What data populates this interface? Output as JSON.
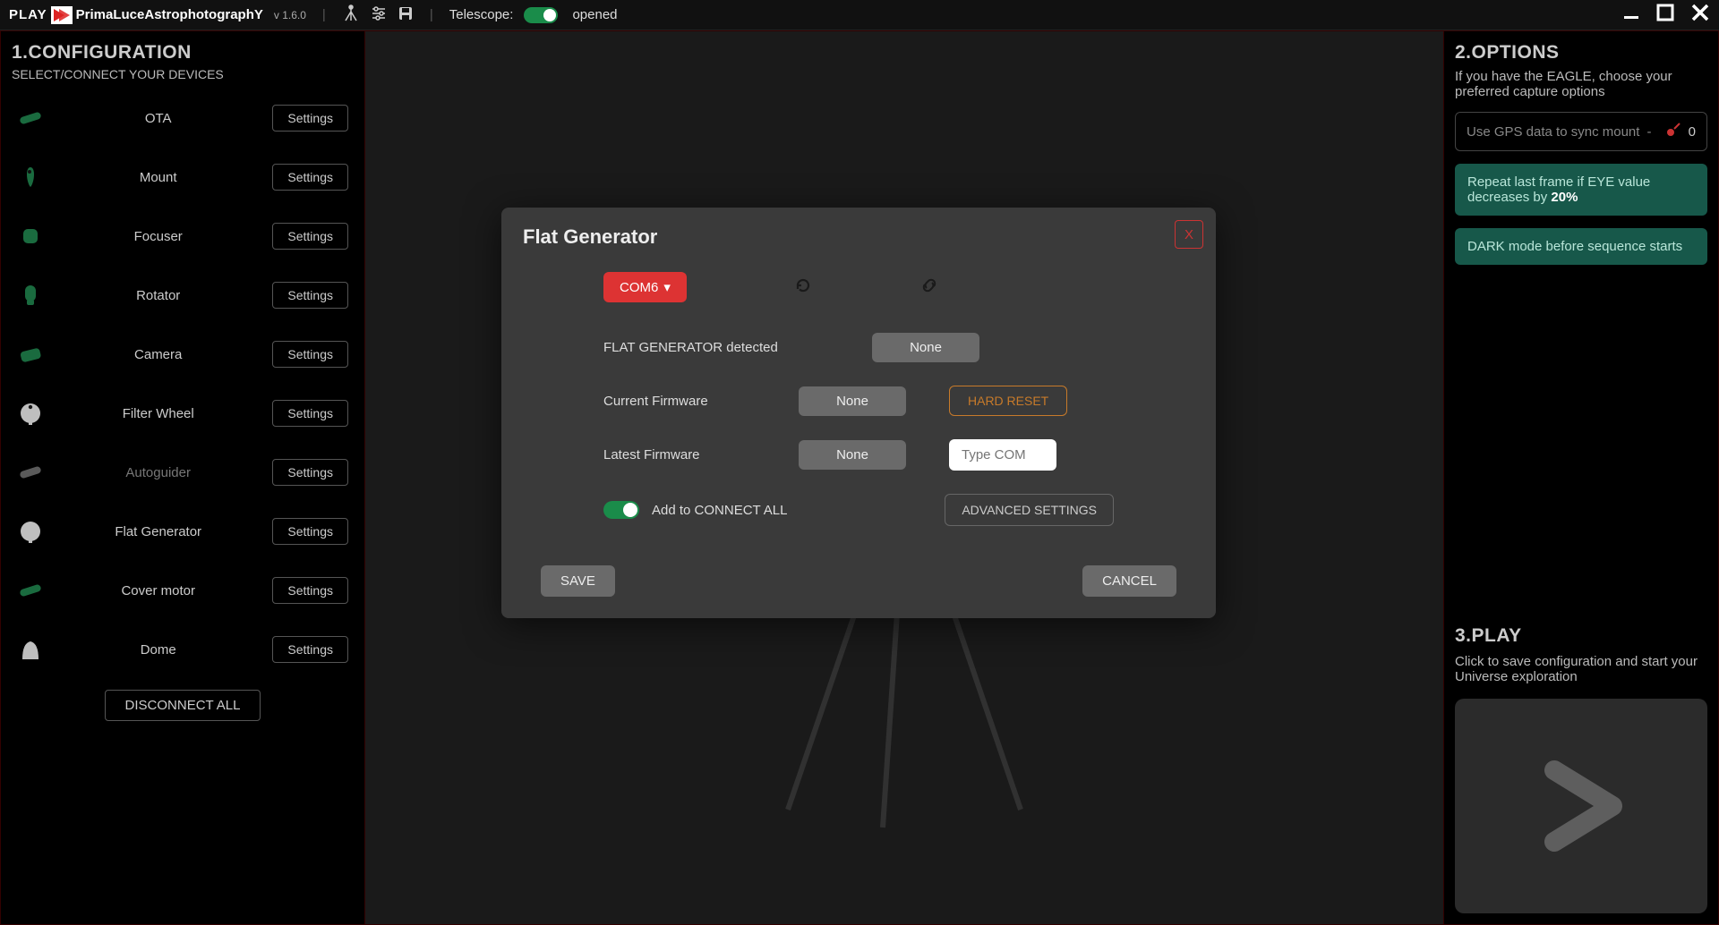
{
  "topbar": {
    "play": "PLAY",
    "brand_parts": {
      "p": "P",
      "mid1": "rima",
      "l": "L",
      "mid2": "uce",
      "a": "A",
      "mid3": "strophotograph",
      "y": "Y"
    },
    "version": "v 1.6.0",
    "telescope_label": "Telescope:",
    "telescope_state": "opened"
  },
  "left": {
    "title": "1.CONFIGURATION",
    "subtitle": "SELECT/CONNECT YOUR DEVICES",
    "settings_label": "Settings",
    "devices": [
      {
        "name": "OTA",
        "icon": "ota",
        "color": "#1a6b3f",
        "disabled": false
      },
      {
        "name": "Mount",
        "icon": "mount",
        "color": "#1a6b3f",
        "disabled": false
      },
      {
        "name": "Focuser",
        "icon": "focuser",
        "color": "#1a6b3f",
        "disabled": false
      },
      {
        "name": "Rotator",
        "icon": "rotator",
        "color": "#1a6b3f",
        "disabled": false
      },
      {
        "name": "Camera",
        "icon": "camera",
        "color": "#1a6b3f",
        "disabled": false
      },
      {
        "name": "Filter Wheel",
        "icon": "filterwheel",
        "color": "#bfbfbf",
        "disabled": false
      },
      {
        "name": "Autoguider",
        "icon": "autoguider",
        "color": "#5a5a5a",
        "disabled": true
      },
      {
        "name": "Flat Generator",
        "icon": "flat",
        "color": "#bfbfbf",
        "disabled": false
      },
      {
        "name": "Cover motor",
        "icon": "cover",
        "color": "#1a6b3f",
        "disabled": false
      },
      {
        "name": "Dome",
        "icon": "dome",
        "color": "#bfbfbf",
        "disabled": false
      }
    ],
    "disconnect": "DISCONNECT ALL"
  },
  "right": {
    "title": "2.OPTIONS",
    "help": "If you have the EAGLE, choose your preferred capture options",
    "gps_label": "Use GPS data to sync mount",
    "gps_suffix": "-",
    "gps_count": "0",
    "repeat_prefix": "Repeat last frame if EYE value decreases by ",
    "repeat_value": "20%",
    "dark_label": "DARK mode before sequence starts",
    "play_title": "3.PLAY",
    "play_help": "Click to save configuration and start your Universe exploration"
  },
  "modal": {
    "title": "Flat Generator",
    "close": "X",
    "com": "COM6",
    "detected_label": "FLAT GENERATOR detected",
    "detected_value": "None",
    "current_fw_label": "Current Firmware",
    "current_fw_value": "None",
    "hard_reset": "HARD RESET",
    "latest_fw_label": "Latest Firmware",
    "latest_fw_value": "None",
    "com_placeholder": "Type COM",
    "connect_all": "Add to CONNECT ALL",
    "advanced": "ADVANCED SETTINGS",
    "save": "SAVE",
    "cancel": "CANCEL"
  }
}
